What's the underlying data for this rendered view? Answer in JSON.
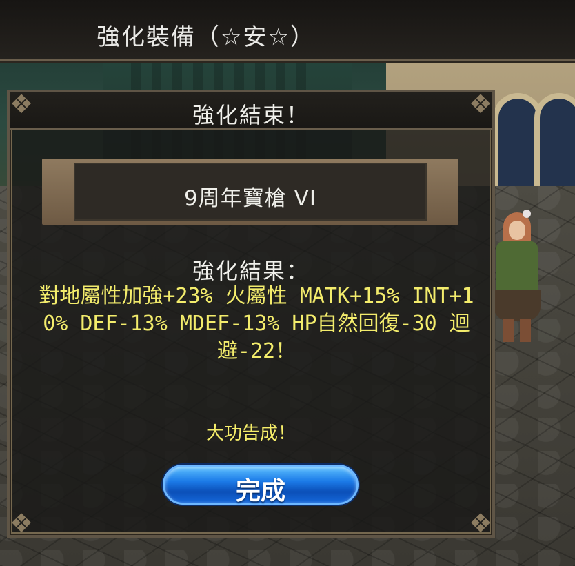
{
  "window": {
    "title": "強化裝備（☆安☆）"
  },
  "dialog": {
    "title": "強化結束！",
    "item_name": "9周年寶槍 VI",
    "result_label": "強化結果：",
    "result_text": "對地屬性加強+23% 火屬性 MATK+15% INT+10% DEF-13% MDEF-13% HP自然回復-30 迴避-22！",
    "success_text": "大功告成！",
    "done_label": "完成"
  },
  "colors": {
    "result_text": "#f3ec6c",
    "button_blue": "#1c7be8"
  },
  "icons": [
    "corner-ornament-icon"
  ]
}
